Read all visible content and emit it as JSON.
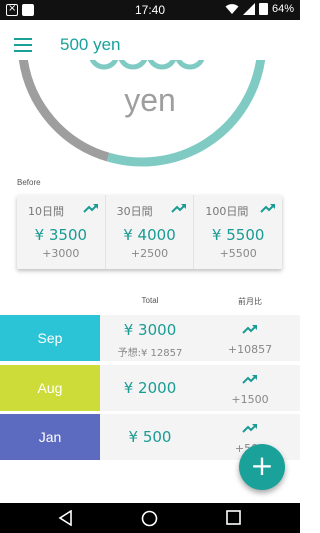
{
  "status_bar": {
    "time": "17:40",
    "battery": "64%",
    "left_icons": [
      "notification-x-icon",
      "image-icon"
    ],
    "right_icons": [
      "wifi-icon",
      "signal-icon",
      "battery-icon"
    ]
  },
  "app_bar": {
    "title": "500 yen",
    "menu_icon": "menu-icon"
  },
  "gauge": {
    "unit": "yen",
    "progress_fraction": 0.6,
    "track_color": "#9e9e9e",
    "fill_color": "#7fcbc4"
  },
  "before": {
    "label": "Before",
    "periods": [
      {
        "label": "10日間",
        "value": "¥ 3500",
        "diff": "+3000",
        "icon": "trending-up-icon"
      },
      {
        "label": "30日間",
        "value": "¥ 4000",
        "diff": "+2500",
        "icon": "trending-up-icon"
      },
      {
        "label": "100日間",
        "value": "¥ 5500",
        "diff": "+5500",
        "icon": "trending-up-icon"
      }
    ]
  },
  "table": {
    "headers": {
      "total": "Total",
      "compare": "前月比"
    },
    "rows": [
      {
        "month": "Sep",
        "color": "#2bc3d6",
        "total": "¥ 3000",
        "forecast": "予想:¥ 12857",
        "compare": "+10857",
        "icon": "trending-up-icon"
      },
      {
        "month": "Aug",
        "color": "#cddc39",
        "total": "¥ 2000",
        "forecast": "",
        "compare": "+1500",
        "icon": "trending-up-icon"
      },
      {
        "month": "Jan",
        "color": "#5c6bc0",
        "total": "¥ 500",
        "forecast": "",
        "compare": "+500",
        "icon": "trending-up-icon"
      }
    ]
  },
  "fab": {
    "label": "+",
    "icon": "add-icon",
    "color": "#1aa19a"
  },
  "nav_bar": {
    "icons": [
      "back-icon",
      "home-icon",
      "recents-icon"
    ]
  },
  "colors": {
    "accent": "#1aa19a",
    "value_text": "#1a9b94"
  }
}
